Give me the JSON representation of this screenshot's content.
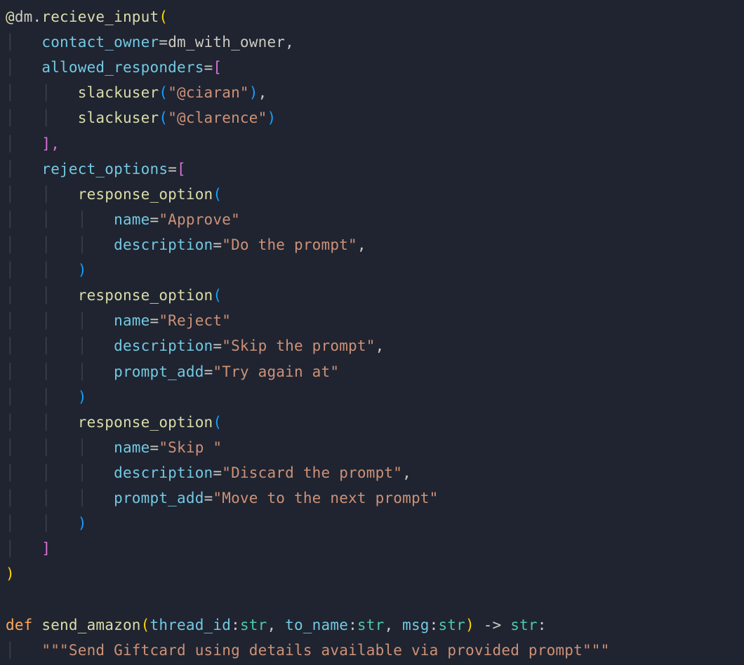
{
  "decorator": {
    "at": "@",
    "module": "dm",
    "dot": ".",
    "method": "recieve_input",
    "open": "(",
    "close": ")",
    "args": {
      "contact_owner": {
        "key": "contact_owner",
        "eq": "=",
        "val": "dm_with_owner",
        "comma": ","
      },
      "allowed_responders": {
        "key": "allowed_responders",
        "eq": "=",
        "open": "[",
        "close_line": "],",
        "items": [
          {
            "func": "slackuser",
            "open": "(",
            "arg": "\"@ciaran\"",
            "close": ")",
            "comma": ","
          },
          {
            "func": "slackuser",
            "open": "(",
            "arg": "\"@clarence\"",
            "close": ")"
          }
        ]
      },
      "reject_options": {
        "key": "reject_options",
        "eq": "=",
        "open": "[",
        "close": "]",
        "items": [
          {
            "func": "response_option",
            "open": "(",
            "close": ")",
            "lines": [
              {
                "key": "name",
                "eq": "=",
                "val": "\"Approve\""
              },
              {
                "key": "description",
                "eq": "=",
                "val": "\"Do the prompt\"",
                "comma": ","
              }
            ]
          },
          {
            "func": "response_option",
            "open": "(",
            "close": ")",
            "lines": [
              {
                "key": "name",
                "eq": "=",
                "val": "\"Reject\""
              },
              {
                "key": "description",
                "eq": "=",
                "val": "\"Skip the prompt\"",
                "comma": ","
              },
              {
                "key": "prompt_add",
                "eq": "=",
                "val": "\"Try again at\""
              }
            ]
          },
          {
            "func": "response_option",
            "open": "(",
            "close": ")",
            "lines": [
              {
                "key": "name",
                "eq": "=",
                "val": "\"Skip \""
              },
              {
                "key": "description",
                "eq": "=",
                "val": "\"Discard the prompt\"",
                "comma": ","
              },
              {
                "key": "prompt_add",
                "eq": "=",
                "val": "\"Move to the next prompt\""
              }
            ]
          }
        ]
      }
    }
  },
  "funcdef": {
    "kw": "def",
    "name": "send_amazon",
    "open": "(",
    "params": [
      {
        "name": "thread_id",
        "colon": ":",
        "type": "str",
        "comma": ", "
      },
      {
        "name": "to_name",
        "colon": ":",
        "type": "str",
        "comma": ", "
      },
      {
        "name": "msg",
        "colon": ":",
        "type": "str",
        "comma": ""
      }
    ],
    "close": ")",
    "arrow": " -> ",
    "rettype": "str",
    "colon": ":",
    "docstring": "\"\"\"Send Giftcard using details available via provided prompt\"\"\""
  },
  "ind": {
    "i0": "",
    "i1": "    ",
    "i2": "        ",
    "i3": "            "
  },
  "guide_chars": {
    "l1": "│",
    "l2": "│   │",
    "l3": "│   │   │"
  }
}
